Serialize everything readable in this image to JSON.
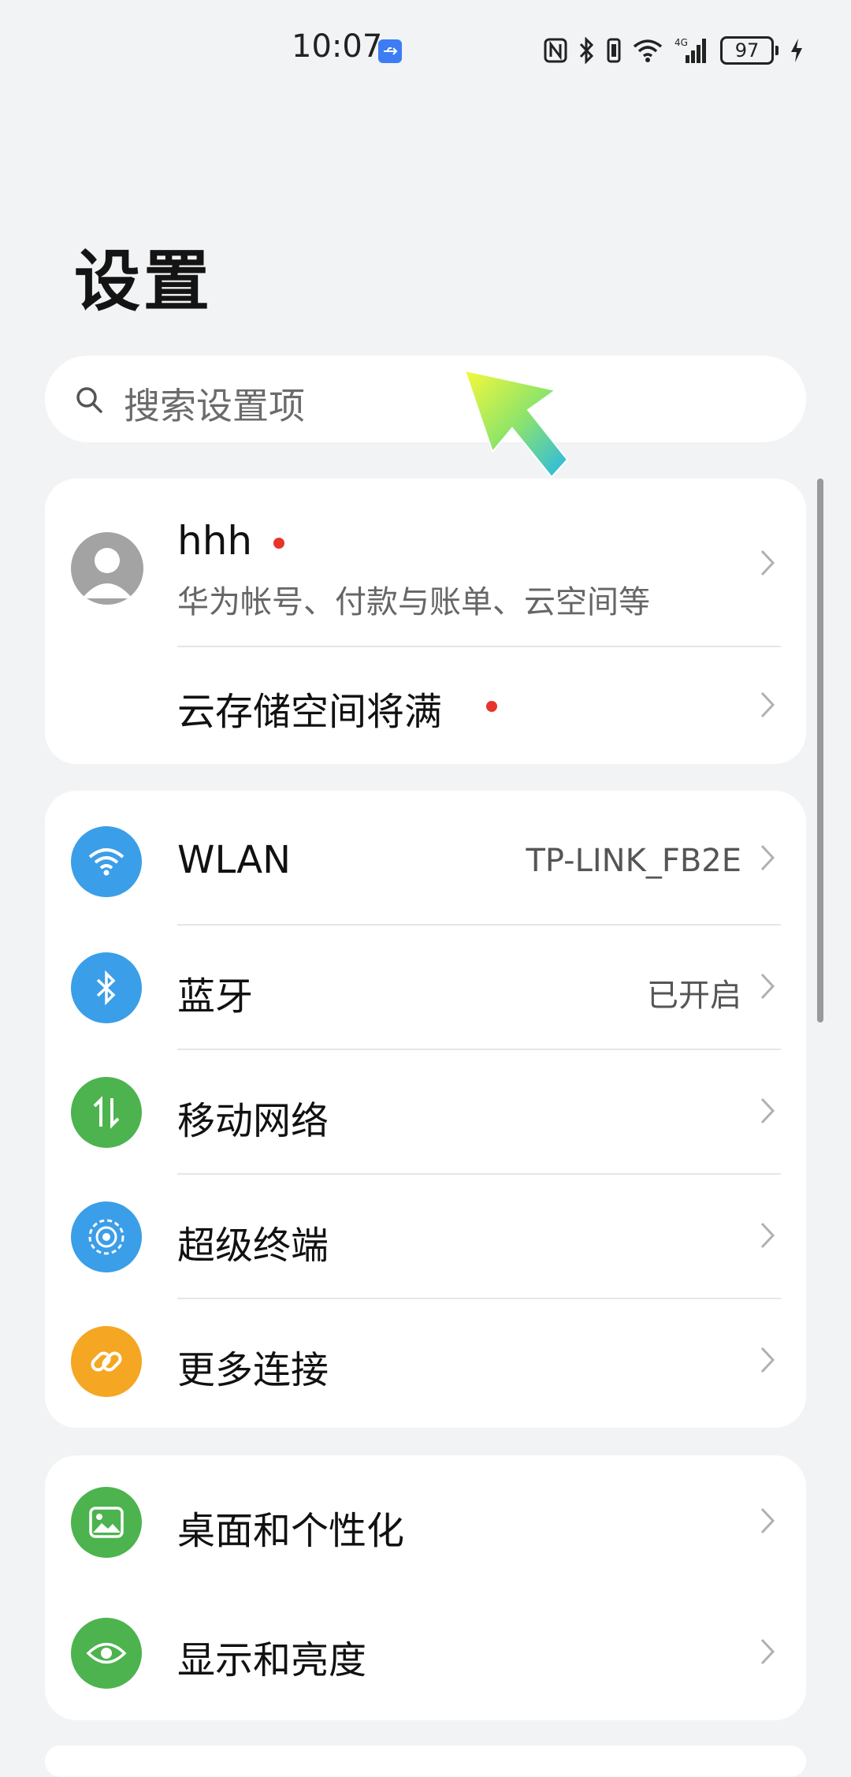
{
  "status_bar": {
    "time": "10:07",
    "battery": "97",
    "icons": [
      "usb-icon",
      "nfc-icon",
      "bluetooth-icon",
      "vibrate-icon",
      "wifi-icon",
      "signal-icon",
      "charging-icon"
    ],
    "network_type": "4G"
  },
  "page": {
    "title": "设置"
  },
  "search": {
    "placeholder": "搜索设置项"
  },
  "account": {
    "name": "hhh",
    "subtitle": "华为帐号、付款与账单、云空间等",
    "storage_notice": "云存储空间将满"
  },
  "connectivity": [
    {
      "label": "WLAN",
      "value": "TP-LINK_FB2E",
      "icon": "wifi-icon",
      "color": "#3b9ee8"
    },
    {
      "label": "蓝牙",
      "value": "已开启",
      "icon": "bluetooth-icon",
      "color": "#3b9ee8"
    },
    {
      "label": "移动网络",
      "value": "",
      "icon": "mobile-data-icon",
      "color": "#4cb34f"
    },
    {
      "label": "超级终端",
      "value": "",
      "icon": "super-device-icon",
      "color": "#3b9ee8"
    },
    {
      "label": "更多连接",
      "value": "",
      "icon": "link-icon",
      "color": "#f5a623"
    }
  ],
  "display": [
    {
      "label": "桌面和个性化",
      "icon": "wallpaper-icon",
      "color": "#4cb34f"
    },
    {
      "label": "显示和亮度",
      "icon": "eye-icon",
      "color": "#4cb34f"
    }
  ],
  "colors": {
    "background": "#f1f3f5",
    "card": "#ffffff",
    "notification_dot": "#e8352b"
  }
}
